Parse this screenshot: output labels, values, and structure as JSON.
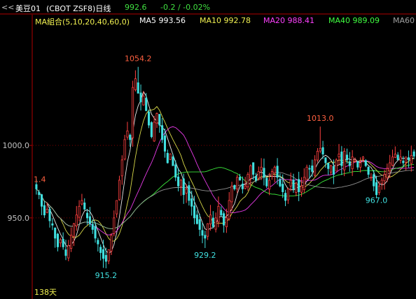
{
  "header": {
    "nav_icon": "double-chevron-left-icon",
    "symbol_name": "美豆01",
    "contract": "(CBOT ZSF8)日线",
    "last_price": "992.6",
    "change": "-0.2 / -0.02%"
  },
  "ma_legend": [
    {
      "label": "MA組合(5,10,20,40,60,0)",
      "color": "#f0f050"
    },
    {
      "label": "MA5 993.56",
      "color": "#ffffff"
    },
    {
      "label": "MA10 992.78",
      "color": "#f0f050"
    },
    {
      "label": "MA20 988.41",
      "color": "#ff40ff"
    },
    {
      "label": "MA40 989.09",
      "color": "#40ff40"
    },
    {
      "label": "MA60",
      "color": "#a0a0a0"
    }
  ],
  "colors": {
    "background": "#000000",
    "up": "#ff4040",
    "down": "#40e0e0",
    "grid": "#800000",
    "axis": "#b00000",
    "high_label": "#ff6040",
    "low_label": "#40e0e0"
  },
  "chart_data": {
    "type": "candlestick",
    "y_ticks": [
      "1000.0",
      "950.0"
    ],
    "y_tick_values": [
      1000,
      950
    ],
    "ylim": [
      895,
      1082
    ],
    "grid": true,
    "left_edge_label": "1.4",
    "bars_label": "138天",
    "annotations": [
      {
        "text": "1054.2",
        "bar": 38,
        "value": 1054.2,
        "kind": "high"
      },
      {
        "text": "915.2",
        "bar": 26,
        "value": 915.2,
        "kind": "low"
      },
      {
        "text": "929.2",
        "bar": 63,
        "value": 929.2,
        "kind": "low"
      },
      {
        "text": "1013.0",
        "bar": 106,
        "value": 1013.0,
        "kind": "high"
      },
      {
        "text": "967.0",
        "bar": 127,
        "value": 967.0,
        "kind": "low"
      }
    ],
    "close": [
      970,
      966,
      958,
      952,
      956,
      948,
      945,
      936,
      930,
      935,
      930,
      924,
      931,
      938,
      946,
      952,
      958,
      962,
      956,
      950,
      946,
      942,
      936,
      932,
      926,
      922,
      920,
      928,
      938,
      950,
      962,
      976,
      990,
      1004,
      1010,
      1004,
      1040,
      1046,
      1036,
      1030,
      1034,
      1024,
      1014,
      1006,
      1016,
      1022,
      1014,
      1004,
      996,
      988,
      994,
      986,
      978,
      972,
      976,
      966,
      970,
      962,
      958,
      950,
      946,
      942,
      938,
      936,
      946,
      952,
      944,
      950,
      958,
      952,
      945,
      950,
      962,
      972,
      970,
      978,
      976,
      970,
      972,
      980,
      986,
      980,
      976,
      982,
      985,
      978,
      972,
      976,
      982,
      985,
      978,
      972,
      968,
      962,
      970,
      976,
      970,
      974,
      968,
      972,
      978,
      985,
      984,
      982,
      990,
      996,
      998,
      994,
      988,
      984,
      986,
      980,
      990,
      994,
      986,
      996,
      990,
      986,
      992,
      990,
      985,
      988,
      992,
      986,
      980,
      978,
      972,
      966,
      972,
      976,
      980,
      984,
      988,
      992,
      994,
      990,
      992,
      988,
      992,
      990,
      993,
      992.6
    ]
  }
}
